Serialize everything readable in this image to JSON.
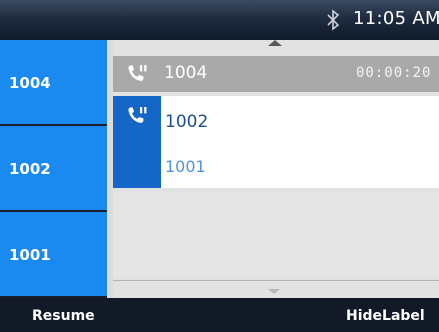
{
  "status_bar": {
    "time": "11:05 AM",
    "icons": [
      "bluetooth-icon"
    ]
  },
  "line_keys": [
    {
      "label": "1004"
    },
    {
      "label": "1002"
    },
    {
      "label": "1001"
    }
  ],
  "calls": {
    "held": {
      "number": "1004",
      "duration": "00:00:20",
      "icon": "phone-icon"
    },
    "active": {
      "number": "1002",
      "secondary": "1001",
      "icon": "phone-icon"
    }
  },
  "softkeys": {
    "left": "Resume",
    "right": "HideLabel"
  },
  "colors": {
    "line_key_blue": "#1a89f0",
    "active_icon_bg": "#1467c6",
    "held_row_gray": "#a9a9a9",
    "active_number": "#1c4f8f",
    "secondary_number": "#4f93dc",
    "status_bar": "#1f2c40"
  }
}
